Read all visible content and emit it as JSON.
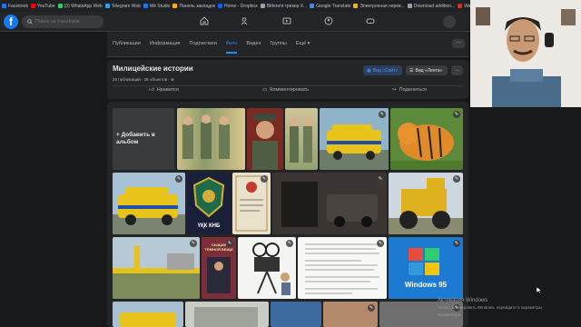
{
  "bookmarks": [
    {
      "label": "Facebook",
      "color": "#1877f2"
    },
    {
      "label": "YouTube",
      "color": "#ff0000"
    },
    {
      "label": "(3) WhatsApp Web",
      "color": "#25d366"
    },
    {
      "label": "Telegram Web",
      "color": "#2aa3ef"
    },
    {
      "label": "Mé Studio",
      "color": "#1877f2"
    },
    {
      "label": "Панель закладок",
      "color": "#f4b400"
    },
    {
      "label": "Home - Dropbox",
      "color": "#0061ff"
    },
    {
      "label": "Bitferent трекер X...",
      "color": "#9aa0a6"
    },
    {
      "label": "Google Translate",
      "color": "#4285f4"
    },
    {
      "label": "Электронная перев...",
      "color": "#f4b400"
    },
    {
      "label": "Download addition...",
      "color": "#9aa0a6"
    },
    {
      "label": "War Thunder — фо...",
      "color": "#c0392b"
    },
    {
      "label": "Закл...",
      "color": "#f4b400"
    }
  ],
  "nav": {
    "logo": "f",
    "search_placeholder": "Поиск на Facebook"
  },
  "tabs": [
    {
      "label": "Публикации"
    },
    {
      "label": "Информация"
    },
    {
      "label": "Подписчики"
    },
    {
      "label": "Фото"
    },
    {
      "label": "Видео"
    },
    {
      "label": "Группы"
    },
    {
      "label": "Ещё ▾"
    }
  ],
  "more_label": "···",
  "page": {
    "title": "Милицейские истории",
    "meta": "25 публикаций · 26 объектов · ⊕",
    "view_site": "Вид «Сайт»",
    "view_feed": "Вид «Лента»",
    "dots": "···",
    "like": "Нравится",
    "comment": "Комментировать",
    "share": "Поделиться"
  },
  "album": {
    "add_label": "+ Добавить в альбом"
  },
  "tiles": {
    "kgb_text": "ҮҚК КНБ",
    "book_text": "СЫЩИК ТЕМНОЙ ВЕЩИ",
    "windows_text": "Windows 95"
  },
  "activation": {
    "title": "Активация Windows",
    "sub1": "Чтобы активировать Windows, перейдите в параметры",
    "sub2": "компьютера."
  },
  "colors": {
    "accent": "#2d88ff",
    "fb_blue": "#1877f2",
    "bg": "#18191a",
    "card": "#242526"
  }
}
